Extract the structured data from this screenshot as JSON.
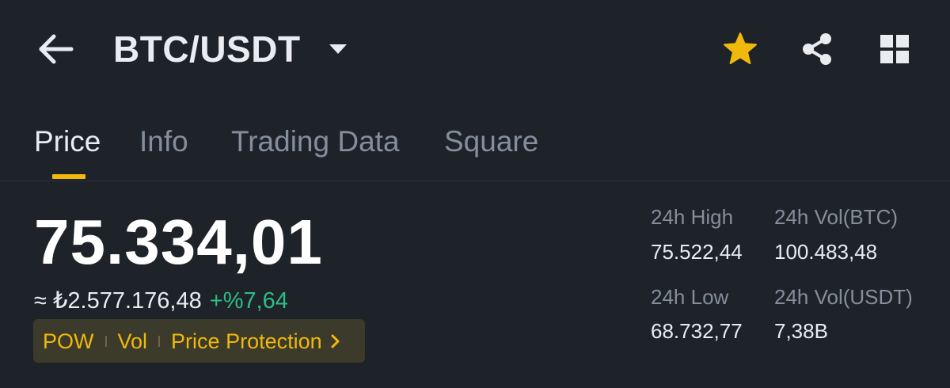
{
  "header": {
    "back_icon": "arrow-left-icon",
    "pair": "BTC/USDT",
    "caret_icon": "caret-down-icon",
    "favorite_icon": "star-icon",
    "share_icon": "share-icon",
    "grid_icon": "grid-icon"
  },
  "tabs": [
    {
      "label": "Price",
      "active": true
    },
    {
      "label": "Info",
      "active": false
    },
    {
      "label": "Trading Data",
      "active": false
    },
    {
      "label": "Square",
      "active": false
    }
  ],
  "price": {
    "last": "75.334,01",
    "fiat": "≈ ₺2.577.176,48",
    "change": "+%7,64"
  },
  "tags": {
    "items": [
      "POW",
      "Vol",
      "Price Protection"
    ],
    "chevron_icon": "chevron-right-icon"
  },
  "stats": {
    "high_label": "24h High",
    "high_value": "75.522,44",
    "low_label": "24h Low",
    "low_value": "68.732,77",
    "vol_base_label": "24h Vol(BTC)",
    "vol_base_value": "100.483,48",
    "vol_quote_label": "24h Vol(USDT)",
    "vol_quote_value": "7,38B"
  },
  "colors": {
    "background": "#1e2329",
    "accent": "#f0b90b",
    "positive": "#2ebd85",
    "muted": "#848e9c",
    "text": "#eaecef"
  }
}
